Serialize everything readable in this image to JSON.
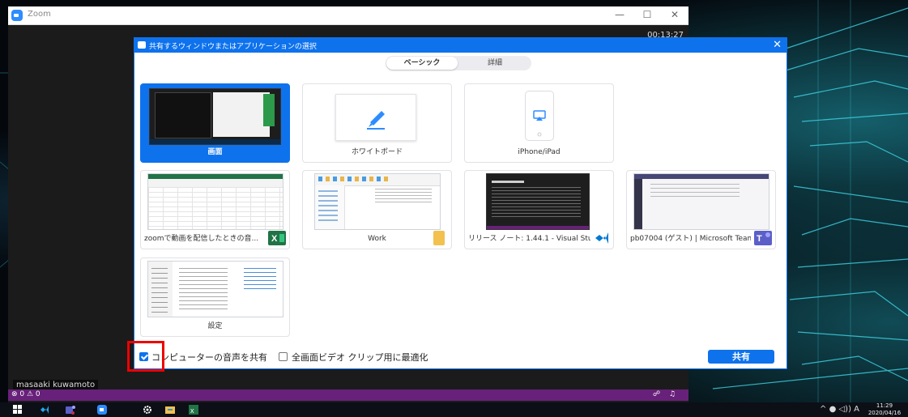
{
  "zoom_window": {
    "title": "Zoom",
    "controls": {
      "minimize": "—",
      "maximize": "☐",
      "close": "✕"
    },
    "timer": "00:13:27",
    "participant_name": "masaaki kuwamoto"
  },
  "dialog": {
    "title": "共有するウィンドウまたはアプリケーションの選択",
    "close": "✕",
    "tabs": [
      {
        "label": "ベーシック",
        "active": true
      },
      {
        "label": "詳細",
        "active": false
      }
    ],
    "tiles": [
      {
        "label": "画面",
        "selected": true,
        "kind": "screen"
      },
      {
        "label": "ホワイトボード",
        "selected": false,
        "kind": "whiteboard",
        "icon": "pen-icon"
      },
      {
        "label": "iPhone/iPad",
        "selected": false,
        "kind": "iphone",
        "icon": "airplay-icon"
      },
      {
        "label": "zoomで動画を配信したときの音...",
        "selected": false,
        "kind": "window",
        "app_icon": "excel-icon"
      },
      {
        "label": "Work",
        "selected": false,
        "kind": "window",
        "app_icon": "folder-icon"
      },
      {
        "label": "リリース ノート: 1.44.1 - Visual Stud...",
        "selected": false,
        "kind": "window",
        "app_icon": "vscode-icon"
      },
      {
        "label": "pb07004 (ゲスト) | Microsoft Teams",
        "selected": false,
        "kind": "window",
        "app_icon": "teams-icon"
      },
      {
        "label": "設定",
        "selected": false,
        "kind": "window"
      }
    ],
    "options": [
      {
        "label": "コンピューターの音声を共有",
        "checked": true
      },
      {
        "label": "全画面ビデオ クリップ用に最適化",
        "checked": false
      }
    ],
    "share_button": "共有"
  },
  "status_bar": {
    "left": "⊗ 0 ⚠ 0",
    "right": "☍ ♫"
  },
  "taskbar": {
    "icons": [
      "windows-start-icon",
      "vscode-icon",
      "teams-icon",
      "zoom-icon",
      "settings-icon",
      "file-explorer-icon",
      "excel-icon"
    ],
    "tray": "^ ● ◁)) A",
    "time": "11:29",
    "date": "2020/04/16"
  },
  "colors": {
    "zoom_blue": "#0e72ed",
    "highlight_red": "#e00000",
    "vscode_purple": "#68217a"
  }
}
